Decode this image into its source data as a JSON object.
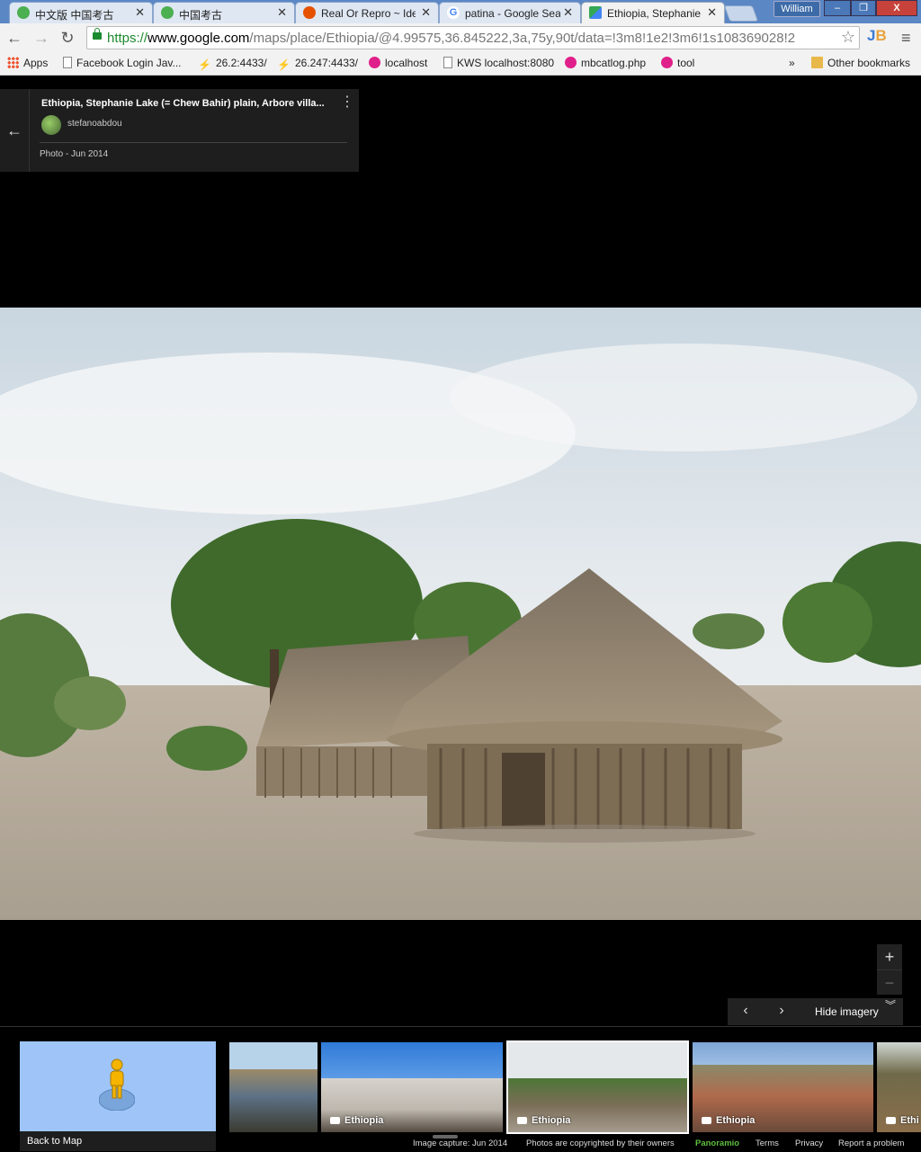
{
  "tabs": [
    {
      "title": "中文版 中国考古",
      "color": "#4caf50"
    },
    {
      "title": "中国考古",
      "color": "#4caf50"
    },
    {
      "title": "Real Or Repro ~ Ide",
      "color": "#e65100"
    },
    {
      "title": "patina - Google Sea",
      "color": "#4285f4"
    },
    {
      "title": "Ethiopia, Stephanie",
      "color": "#34a853"
    }
  ],
  "tab_close": "✕",
  "user_name": "William",
  "window_controls": {
    "minimize": "–",
    "restore": "❐",
    "close": "X"
  },
  "nav": {
    "back": "←",
    "forward": "→",
    "reload": "↻"
  },
  "url": {
    "scheme": "https://",
    "host": "www.google.com",
    "path": "/maps/place/Ethiopia/@4.99575,36.845222,3a,75y,90t/data=!3m8!1e2!3m6!1s108369028!2"
  },
  "bookmark_star": "☆",
  "extension_label": {
    "a": "J",
    "b": "B"
  },
  "menu_icon": "≡",
  "bookmarks": [
    {
      "label": "Apps",
      "icon": "apps-icon"
    },
    {
      "label": "Facebook Login Jav...",
      "icon": "page-icon"
    },
    {
      "label": "26.2:4433/",
      "icon": "pin-icon"
    },
    {
      "label": "26.247:4433/",
      "icon": "pin-icon"
    },
    {
      "label": "localhost",
      "icon": "mb-icon"
    },
    {
      "label": "KWS localhost:8080",
      "icon": "page-icon"
    },
    {
      "label": "mbcatlog.php",
      "icon": "mb-icon"
    },
    {
      "label": "tool",
      "icon": "mb-icon"
    }
  ],
  "bookmarks_overflow": "»",
  "other_bookmarks": "Other bookmarks",
  "photo_card": {
    "back": "←",
    "title": "Ethiopia, Stephanie Lake (= Chew Bahir) plain, Arbore villa...",
    "author": "stefanoabdou",
    "date": "Photo - Jun 2014",
    "more": "⋮"
  },
  "zoom": {
    "in": "+",
    "out": "−"
  },
  "imagery_nav": {
    "prev": "‹",
    "next": "›",
    "hide_label": "Hide imagery",
    "chevron": "︾"
  },
  "back_to_map": "Back to Map",
  "thumbnails": [
    {
      "label": "",
      "selected": false
    },
    {
      "label": "Ethiopia",
      "selected": false
    },
    {
      "label": "Ethiopia",
      "selected": true
    },
    {
      "label": "Ethiopia",
      "selected": false
    },
    {
      "label": "Ethi",
      "selected": false
    }
  ],
  "footer": {
    "capture": "Image capture: Jun 2014",
    "copyright": "Photos are copyrighted by their owners",
    "brand": "Panoramio",
    "terms": "Terms",
    "privacy": "Privacy",
    "report": "Report a problem"
  }
}
